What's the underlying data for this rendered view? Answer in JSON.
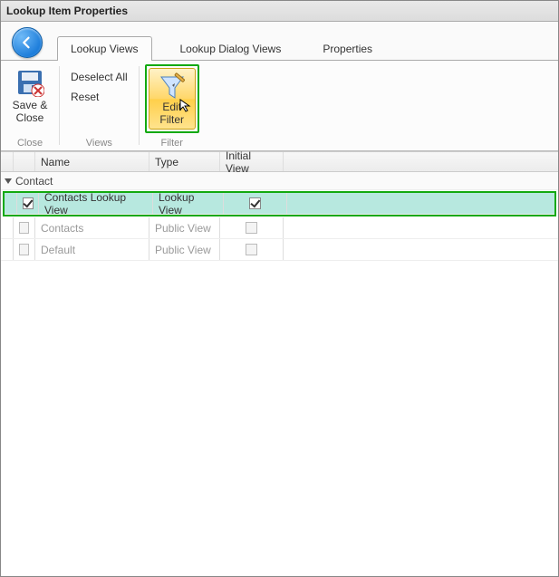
{
  "window": {
    "title": "Lookup Item Properties"
  },
  "tabs": [
    {
      "id": "lookup-views",
      "label": "Lookup Views",
      "active": true
    },
    {
      "id": "lookup-dialog-views",
      "label": "Lookup Dialog Views",
      "active": false
    },
    {
      "id": "properties",
      "label": "Properties",
      "active": false
    }
  ],
  "ribbon": {
    "close": {
      "saveClose": "Save & Close",
      "groupLabel": "Close"
    },
    "views": {
      "deselectAll": "Deselect All",
      "reset": "Reset",
      "groupLabel": "Views"
    },
    "filter": {
      "editFilter_line1": "Edit",
      "editFilter_line2": "Filter",
      "groupLabel": "Filter"
    }
  },
  "grid": {
    "columns": {
      "name": "Name",
      "type": "Type",
      "initial": "Initial View"
    },
    "group": {
      "label": "Contact"
    },
    "rows": [
      {
        "checked": true,
        "name": "Contacts Lookup View",
        "type": "Lookup View",
        "initial": true,
        "selected": true,
        "enabled": true
      },
      {
        "checked": false,
        "name": "Contacts",
        "type": "Public View",
        "initial": false,
        "selected": false,
        "enabled": false
      },
      {
        "checked": false,
        "name": "Default",
        "type": "Public View",
        "initial": false,
        "selected": false,
        "enabled": false
      }
    ]
  },
  "highlight": {
    "color": "#12a910"
  }
}
